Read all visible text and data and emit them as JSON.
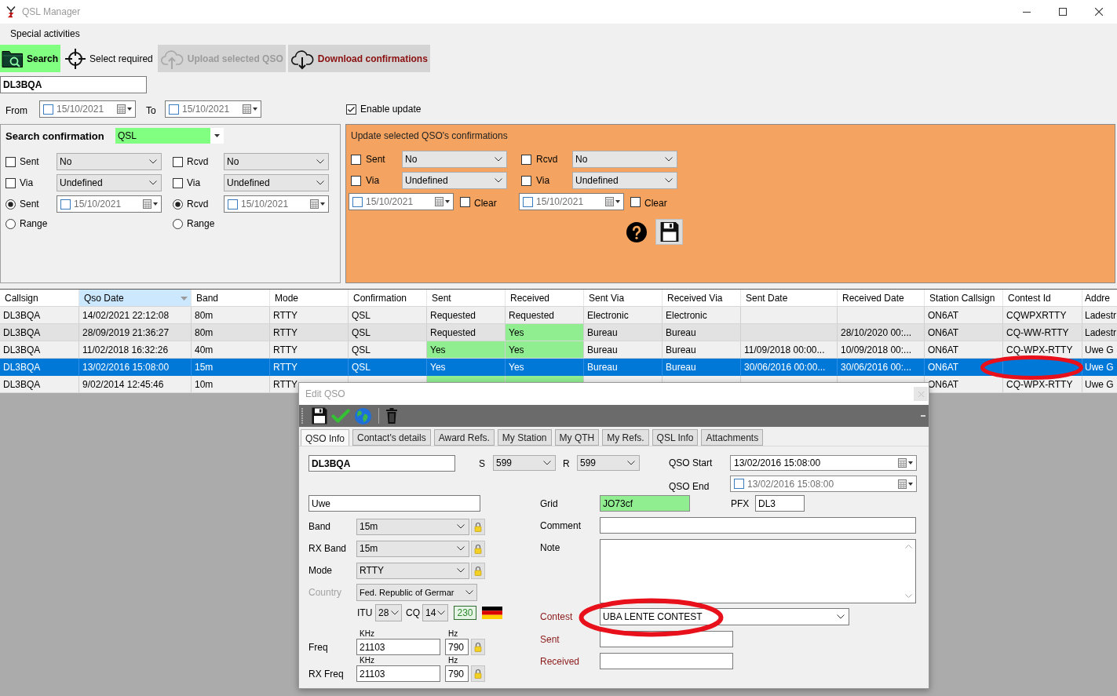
{
  "window": {
    "title": "QSL Manager"
  },
  "menu": [
    {
      "label": "Special activities"
    }
  ],
  "toolbar": [
    {
      "label": "Search",
      "kind": "search",
      "active": true,
      "disabled": false
    },
    {
      "label": "Select required",
      "kind": "target",
      "active": false,
      "disabled": false
    },
    {
      "label": "Upload selected QSO",
      "kind": "upload",
      "active": false,
      "disabled": true
    },
    {
      "label": "Download confirmations",
      "kind": "download",
      "active": false,
      "disabled": false
    }
  ],
  "callsign": {
    "value": "DL3BQA"
  },
  "date_range": [
    {
      "label": "From",
      "value": "15/10/2021",
      "checked": false
    },
    {
      "label": "To",
      "value": "15/10/2021",
      "checked": false
    }
  ],
  "enable_update": {
    "label": "Enable update",
    "checked": true
  },
  "search_panel": {
    "title": "Search confirmation",
    "type": {
      "value": "QSL"
    },
    "columns": [
      {
        "status": {
          "label": "Sent",
          "checked": false,
          "value": "No"
        },
        "via": {
          "label": "Via",
          "checked": false,
          "value": "Undefined"
        },
        "options": [
          {
            "label": "Sent",
            "selected": true,
            "date": {
              "value": "15/10/2021",
              "checked": false
            }
          },
          {
            "label": "Range",
            "selected": false
          }
        ]
      },
      {
        "status": {
          "label": "Rcvd",
          "checked": false,
          "value": "No"
        },
        "via": {
          "label": "Via",
          "checked": false,
          "value": "Undefined"
        },
        "options": [
          {
            "label": "Rcvd",
            "selected": true,
            "date": {
              "value": "15/10/2021",
              "checked": false
            }
          },
          {
            "label": "Range",
            "selected": false
          }
        ]
      }
    ]
  },
  "update_panel": {
    "title": "Update selected QSO's confirmations",
    "columns": [
      {
        "status": {
          "label": "Sent",
          "checked": false,
          "value": "No"
        },
        "via": {
          "label": "Via",
          "checked": false,
          "value": "Undefined"
        },
        "date": {
          "value": "15/10/2021",
          "checked": false
        },
        "clear": {
          "label": "Clear",
          "checked": false
        }
      },
      {
        "status": {
          "label": "Rcvd",
          "checked": false,
          "value": "No"
        },
        "via": {
          "label": "Via",
          "checked": false,
          "value": "Undefined"
        },
        "date": {
          "value": "15/10/2021",
          "checked": false
        },
        "clear": {
          "label": "Clear",
          "checked": false
        }
      }
    ]
  },
  "table": {
    "columns": [
      {
        "label": "Callsign",
        "sorted": false
      },
      {
        "label": "Qso Date",
        "sorted": true
      },
      {
        "label": "Band",
        "sorted": false
      },
      {
        "label": "Mode",
        "sorted": false
      },
      {
        "label": "Confirmation",
        "sorted": false
      },
      {
        "label": "Sent",
        "sorted": false
      },
      {
        "label": "Received",
        "sorted": false
      },
      {
        "label": "Sent Via",
        "sorted": false
      },
      {
        "label": "Received Via",
        "sorted": false
      },
      {
        "label": "Sent Date",
        "sorted": false
      },
      {
        "label": "Received Date",
        "sorted": false
      },
      {
        "label": "Station Callsign",
        "sorted": false
      },
      {
        "label": "Contest Id",
        "sorted": false
      },
      {
        "label": "Addre",
        "sorted": false
      }
    ],
    "rows": [
      {
        "selected": false,
        "sent_highlight": false,
        "received_highlight": false,
        "contest_circled": false,
        "cells": [
          "DL3BQA",
          "14/02/2021 22:12:08",
          "80m",
          "RTTY",
          "QSL",
          "Requested",
          "Requested",
          "Electronic",
          "Electronic",
          null,
          null,
          "ON6AT",
          "CQWPXRTTY",
          "Ladestr"
        ]
      },
      {
        "selected": false,
        "sent_highlight": false,
        "received_highlight": true,
        "contest_circled": false,
        "cells": [
          "DL3BQA",
          "28/09/2019 21:36:27",
          "80m",
          "RTTY",
          "QSL",
          "Requested",
          "Yes",
          "Bureau",
          "Bureau",
          null,
          "28/10/2020 00:...",
          "ON6AT",
          "CQ-WW-RTTY",
          "Ladestr"
        ]
      },
      {
        "selected": false,
        "sent_highlight": true,
        "received_highlight": true,
        "contest_circled": false,
        "cells": [
          "DL3BQA",
          "11/02/2018 16:32:26",
          "40m",
          "RTTY",
          "QSL",
          "Yes",
          "Yes",
          "Bureau",
          "Bureau",
          "11/09/2018 00:00...",
          "10/09/2018 00:...",
          "ON6AT",
          "CQ-WPX-RTTY",
          "Uwe G"
        ]
      },
      {
        "selected": true,
        "sent_highlight": false,
        "received_highlight": false,
        "contest_circled": true,
        "cells": [
          "DL3BQA",
          "13/02/2016 15:08:00",
          "15m",
          "RTTY",
          "QSL",
          "Yes",
          "Yes",
          "Bureau",
          "Bureau",
          "30/06/2016 00:00...",
          "30/06/2016 00:...",
          "ON6AT",
          null,
          "Uwe G"
        ]
      },
      {
        "selected": false,
        "sent_highlight": true,
        "received_highlight": true,
        "contest_circled": false,
        "cells": [
          "DL3BQA",
          "9/02/2014 12:45:46",
          "10m",
          "RTTY",
          null,
          null,
          null,
          null,
          null,
          null,
          null,
          "ON6AT",
          "CQ-WPX-RTTY",
          "Uwe G"
        ]
      }
    ]
  },
  "edit_dialog": {
    "title": "Edit QSO",
    "tabs": [
      {
        "label": "QSO Info",
        "selected": true
      },
      {
        "label": "Contact's details",
        "selected": false
      },
      {
        "label": "Award Refs.",
        "selected": false
      },
      {
        "label": "My Station",
        "selected": false
      },
      {
        "label": "My QTH",
        "selected": false
      },
      {
        "label": "My Refs.",
        "selected": false
      },
      {
        "label": "QSL Info",
        "selected": false
      },
      {
        "label": "Attachments",
        "selected": false
      }
    ],
    "callsign": {
      "value": "DL3BQA"
    },
    "reports": [
      {
        "label": "S",
        "value": "599"
      },
      {
        "label": "R",
        "value": "599"
      }
    ],
    "qso_start": {
      "label": "QSO Start",
      "value": "13/02/2016 15:08:00"
    },
    "qso_end": {
      "label": "QSO End",
      "value": "13/02/2016 15:08:00",
      "checked": false
    },
    "name": {
      "value": "Uwe"
    },
    "selects": [
      {
        "label": "Band",
        "value": "15m",
        "lock": true,
        "disabled": false
      },
      {
        "label": "RX Band",
        "value": "15m",
        "lock": true,
        "disabled": false
      },
      {
        "label": "Mode",
        "value": "RTTY",
        "lock": true,
        "disabled": false
      },
      {
        "label": "Country",
        "value": "Fed. Republic of Germar",
        "lock": false,
        "disabled": true
      }
    ],
    "zones": {
      "itu": {
        "label": "ITU",
        "value": "28"
      },
      "cq": {
        "label": "CQ",
        "value": "14"
      },
      "dxcc": {
        "value": "230"
      }
    },
    "freqs": [
      {
        "label": "Freq",
        "khz_label": "KHz",
        "khz": "21103",
        "hz_label": "Hz",
        "hz": "790"
      },
      {
        "label": "RX Freq",
        "khz_label": "KHz",
        "khz": "21103",
        "hz_label": "Hz",
        "hz": "790"
      }
    ],
    "grid": {
      "label": "Grid",
      "value": "JO73cf"
    },
    "pfx": {
      "label": "PFX",
      "value": "DL3"
    },
    "comment": {
      "label": "Comment"
    },
    "note": {
      "label": "Note"
    },
    "contest": {
      "label": "Contest",
      "value": "UBA LENTE CONTEST",
      "circled": true
    },
    "contest_sent": {
      "label": "Sent"
    },
    "contest_received": {
      "label": "Received"
    }
  }
}
